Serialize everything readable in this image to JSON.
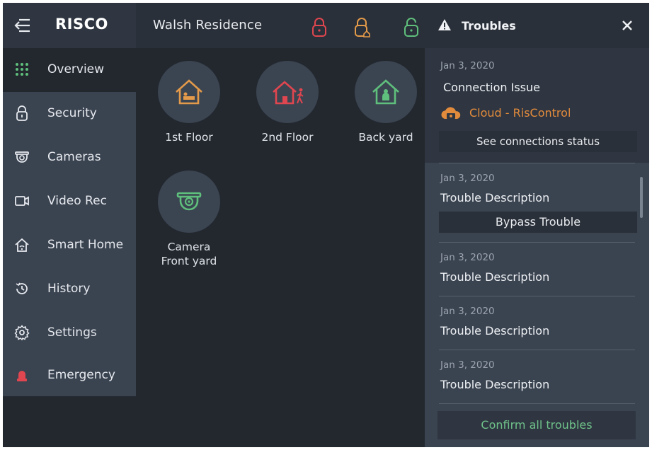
{
  "header": {
    "logo": "RISCO",
    "site_title": "Walsh Residence",
    "locks": [
      {
        "name": "armed",
        "color": "#e0464f"
      },
      {
        "name": "partial",
        "color": "#e39a4a"
      },
      {
        "name": "disarmed",
        "color": "#5fbf7c"
      }
    ]
  },
  "sidebar": {
    "items": [
      {
        "label": "Overview",
        "icon": "grid-icon",
        "active": true
      },
      {
        "label": "Security",
        "icon": "lock-icon"
      },
      {
        "label": "Cameras",
        "icon": "camera-icon"
      },
      {
        "label": "Video Rec",
        "icon": "video-icon"
      },
      {
        "label": "Smart Home",
        "icon": "smart-home-icon"
      },
      {
        "label": "History",
        "icon": "history-icon"
      },
      {
        "label": "Settings",
        "icon": "gear-icon"
      },
      {
        "label": "Emergency",
        "icon": "siren-icon"
      }
    ]
  },
  "main": {
    "tiles": [
      {
        "label": "1st Floor",
        "icon": "house-bed-icon",
        "color": "#e39a4a"
      },
      {
        "label": "2nd Floor",
        "icon": "house-walker-icon",
        "color": "#e0464f"
      },
      {
        "label": "Back yard",
        "icon": "house-person-icon",
        "color": "#5fbf7c"
      },
      {
        "label_1": "Camera",
        "label_2": "Front yard",
        "icon": "camera-icon",
        "color": "#5fbf7c"
      }
    ]
  },
  "troubles": {
    "title": "Troubles",
    "items": [
      {
        "date": "Jan 3, 2020",
        "title": "Connection Issue",
        "source": "Cloud - RisControl",
        "action": "See connections status"
      },
      {
        "date": "Jan 3, 2020",
        "title": "Trouble Description",
        "action": "Bypass Trouble"
      },
      {
        "date": "Jan 3, 2020",
        "title": "Trouble Description"
      },
      {
        "date": "Jan 3, 2020",
        "title": "Trouble Description"
      },
      {
        "date": "Jan 3, 2020",
        "title": "Trouble Description"
      }
    ],
    "confirm_all": "Confirm all troubles"
  }
}
